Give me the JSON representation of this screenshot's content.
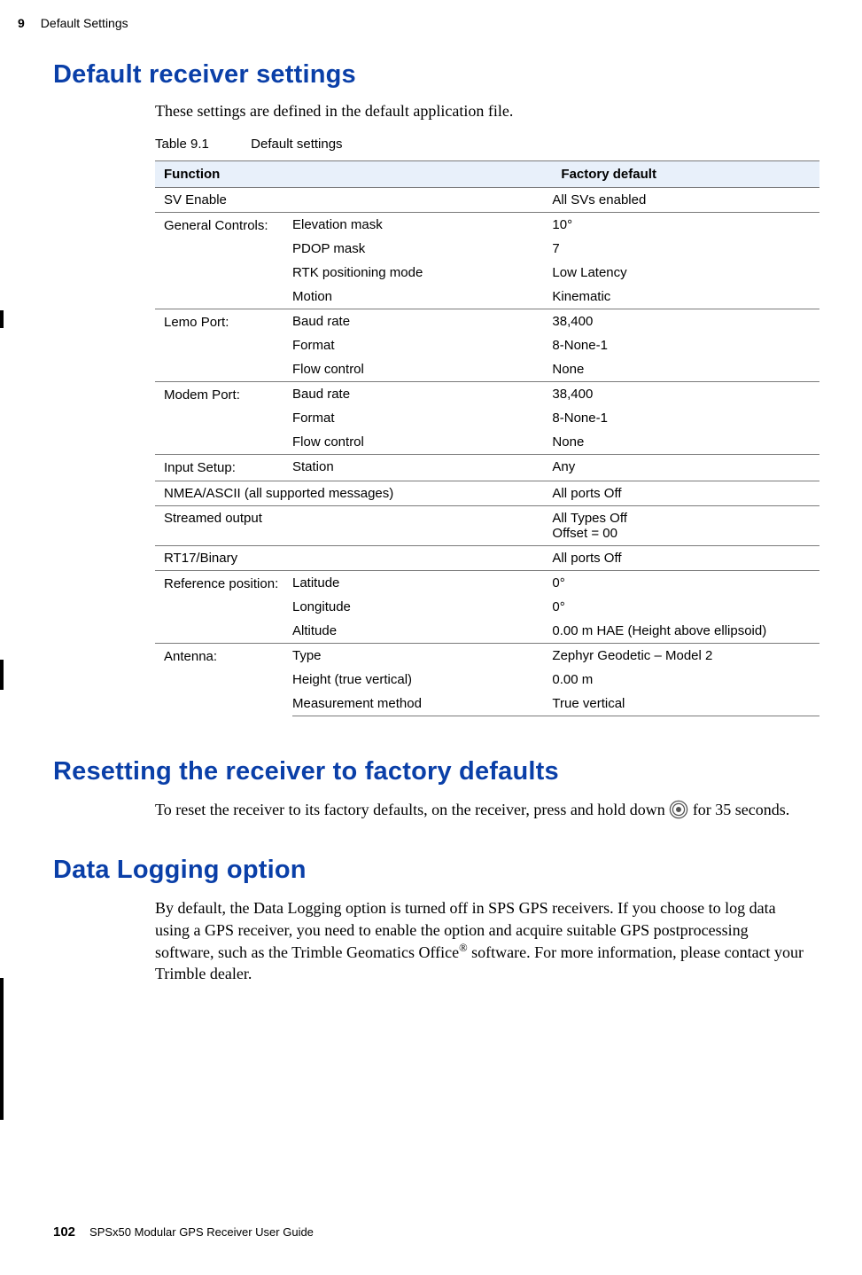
{
  "header": {
    "chapter_num": "9",
    "chapter_title": "Default Settings"
  },
  "footer": {
    "page_num": "102",
    "book_title": "SPSx50 Modular GPS Receiver User Guide"
  },
  "section1": {
    "heading": "Default receiver settings",
    "intro": "These settings are defined in the default application file.",
    "table_caption_num": "Table 9.1",
    "table_caption_title": "Default settings",
    "col_function": "Function",
    "col_default": "Factory default",
    "sv_enable": {
      "fn": "SV Enable",
      "def": "All SVs enabled"
    },
    "general": {
      "group": "General Controls:",
      "elev_mask": {
        "fn": "Elevation mask",
        "def": "10°"
      },
      "pdop_mask": {
        "fn": "PDOP mask",
        "def": "7"
      },
      "rtk_mode": {
        "fn": "RTK positioning mode",
        "def": "Low Latency"
      },
      "motion": {
        "fn": "Motion",
        "def": "Kinematic"
      }
    },
    "lemo": {
      "group": "Lemo Port:",
      "baud": {
        "fn": "Baud rate",
        "def": "38,400"
      },
      "format": {
        "fn": "Format",
        "def": "8-None-1"
      },
      "flow": {
        "fn": "Flow control",
        "def": "None"
      }
    },
    "modem": {
      "group": "Modem Port:",
      "baud": {
        "fn": "Baud rate",
        "def": "38,400"
      },
      "format": {
        "fn": "Format",
        "def": "8-None-1"
      },
      "flow": {
        "fn": "Flow control",
        "def": "None"
      }
    },
    "input": {
      "group": "Input Setup:",
      "station": {
        "fn": "Station",
        "def": "Any"
      }
    },
    "nmea": {
      "fn": "NMEA/ASCII (all supported messages)",
      "def": "All ports Off"
    },
    "streamed": {
      "fn": "Streamed output",
      "def1": "All Types Off",
      "def2": "Offset = 00"
    },
    "rt17": {
      "fn": "RT17/Binary",
      "def": "All ports Off"
    },
    "refpos": {
      "group": "Reference position:",
      "lat": {
        "fn": "Latitude",
        "def": "0°"
      },
      "lon": {
        "fn": "Longitude",
        "def": "0°"
      },
      "alt": {
        "fn": "Altitude",
        "def": "0.00 m HAE (Height above ellipsoid)"
      }
    },
    "antenna": {
      "group": "Antenna:",
      "type": {
        "fn": "Type",
        "def": "Zephyr Geodetic – Model 2"
      },
      "height": {
        "fn": "Height (true vertical)",
        "def": "0.00 m"
      },
      "method": {
        "fn": "Measurement method",
        "def": "True vertical"
      }
    }
  },
  "section2": {
    "heading": "Resetting the receiver to factory defaults",
    "body_pre": "To reset the receiver to its factory defaults, on the receiver, press and hold down ",
    "body_post": " for 35 seconds."
  },
  "section3": {
    "heading": "Data Logging option",
    "body_pre": "By default, the Data Logging option is turned off in SPS GPS receivers. If you choose to log data using a GPS receiver, you need to enable the option and acquire suitable GPS postprocessing software, such as the Trimble Geomatics Office",
    "body_sup": "®",
    "body_post": " software. For more information, please contact your Trimble dealer."
  }
}
